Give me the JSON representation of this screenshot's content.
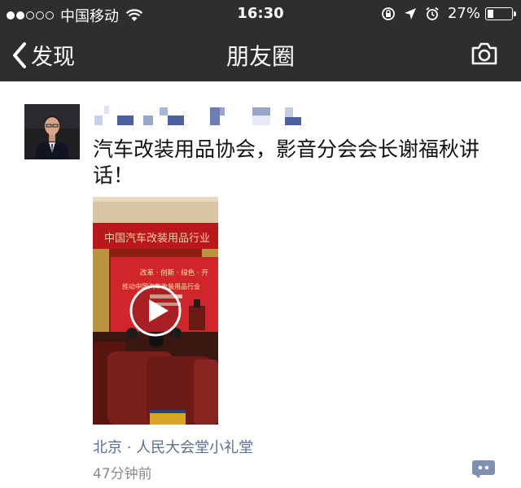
{
  "status_bar": {
    "carrier": "中国移动",
    "time": "16:30",
    "battery_percent": "27%",
    "battery_level": 0.27,
    "signal_bars_filled": 2,
    "signal_bars_total": 5
  },
  "nav": {
    "back_label": "发现",
    "title": "朋友圈",
    "camera_icon": "camera-icon"
  },
  "post": {
    "text": "汽车改装用品协会，影音分会会长谢福秋讲话！",
    "location": "北京 · 人民大会堂小礼堂",
    "time_ago": "47分钟前",
    "video": {
      "banner_text": "中国汽车改装用品行业",
      "screen_line_1": "改革 · 创新 · 绿色 · 开",
      "screen_line_2": "推动中国汽车改装用品行业"
    }
  },
  "colors": {
    "bar_background": "#2e2e2e",
    "link": "#5a6f94",
    "meta": "#8a8a8a"
  }
}
